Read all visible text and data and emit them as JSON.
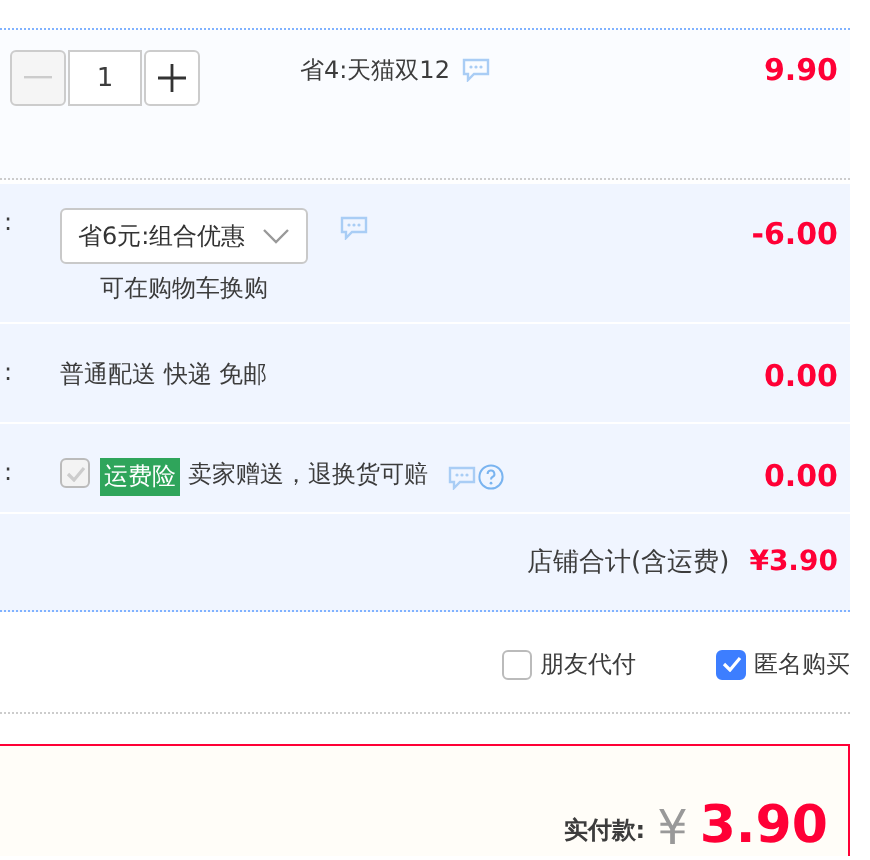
{
  "item": {
    "quantity": "1",
    "minus_disabled": true,
    "promo": "省4:天猫双12",
    "price": "9.90"
  },
  "rows": [
    {
      "kind": "coupon",
      "label": ":",
      "select": "省6元:组合优惠",
      "note": "可在购物车换购",
      "amount": "-6.00"
    },
    {
      "kind": "shipping",
      "label": ":",
      "text": "普通配送 快递 免邮",
      "amount": "0.00"
    },
    {
      "kind": "insurance",
      "label": ":",
      "checked": true,
      "disabled": true,
      "tag": "运费险",
      "text": "卖家赠送，退换货可赔",
      "amount": "0.00"
    }
  ],
  "shop_total": {
    "label": "店铺合计(含运费)",
    "value": "¥3.90"
  },
  "options": [
    {
      "label": "朋友代付",
      "checked": false
    },
    {
      "label": "匿名购买",
      "checked": true
    }
  ],
  "payment": {
    "label": "实付款:",
    "currency": "¥",
    "value": "3.90"
  }
}
